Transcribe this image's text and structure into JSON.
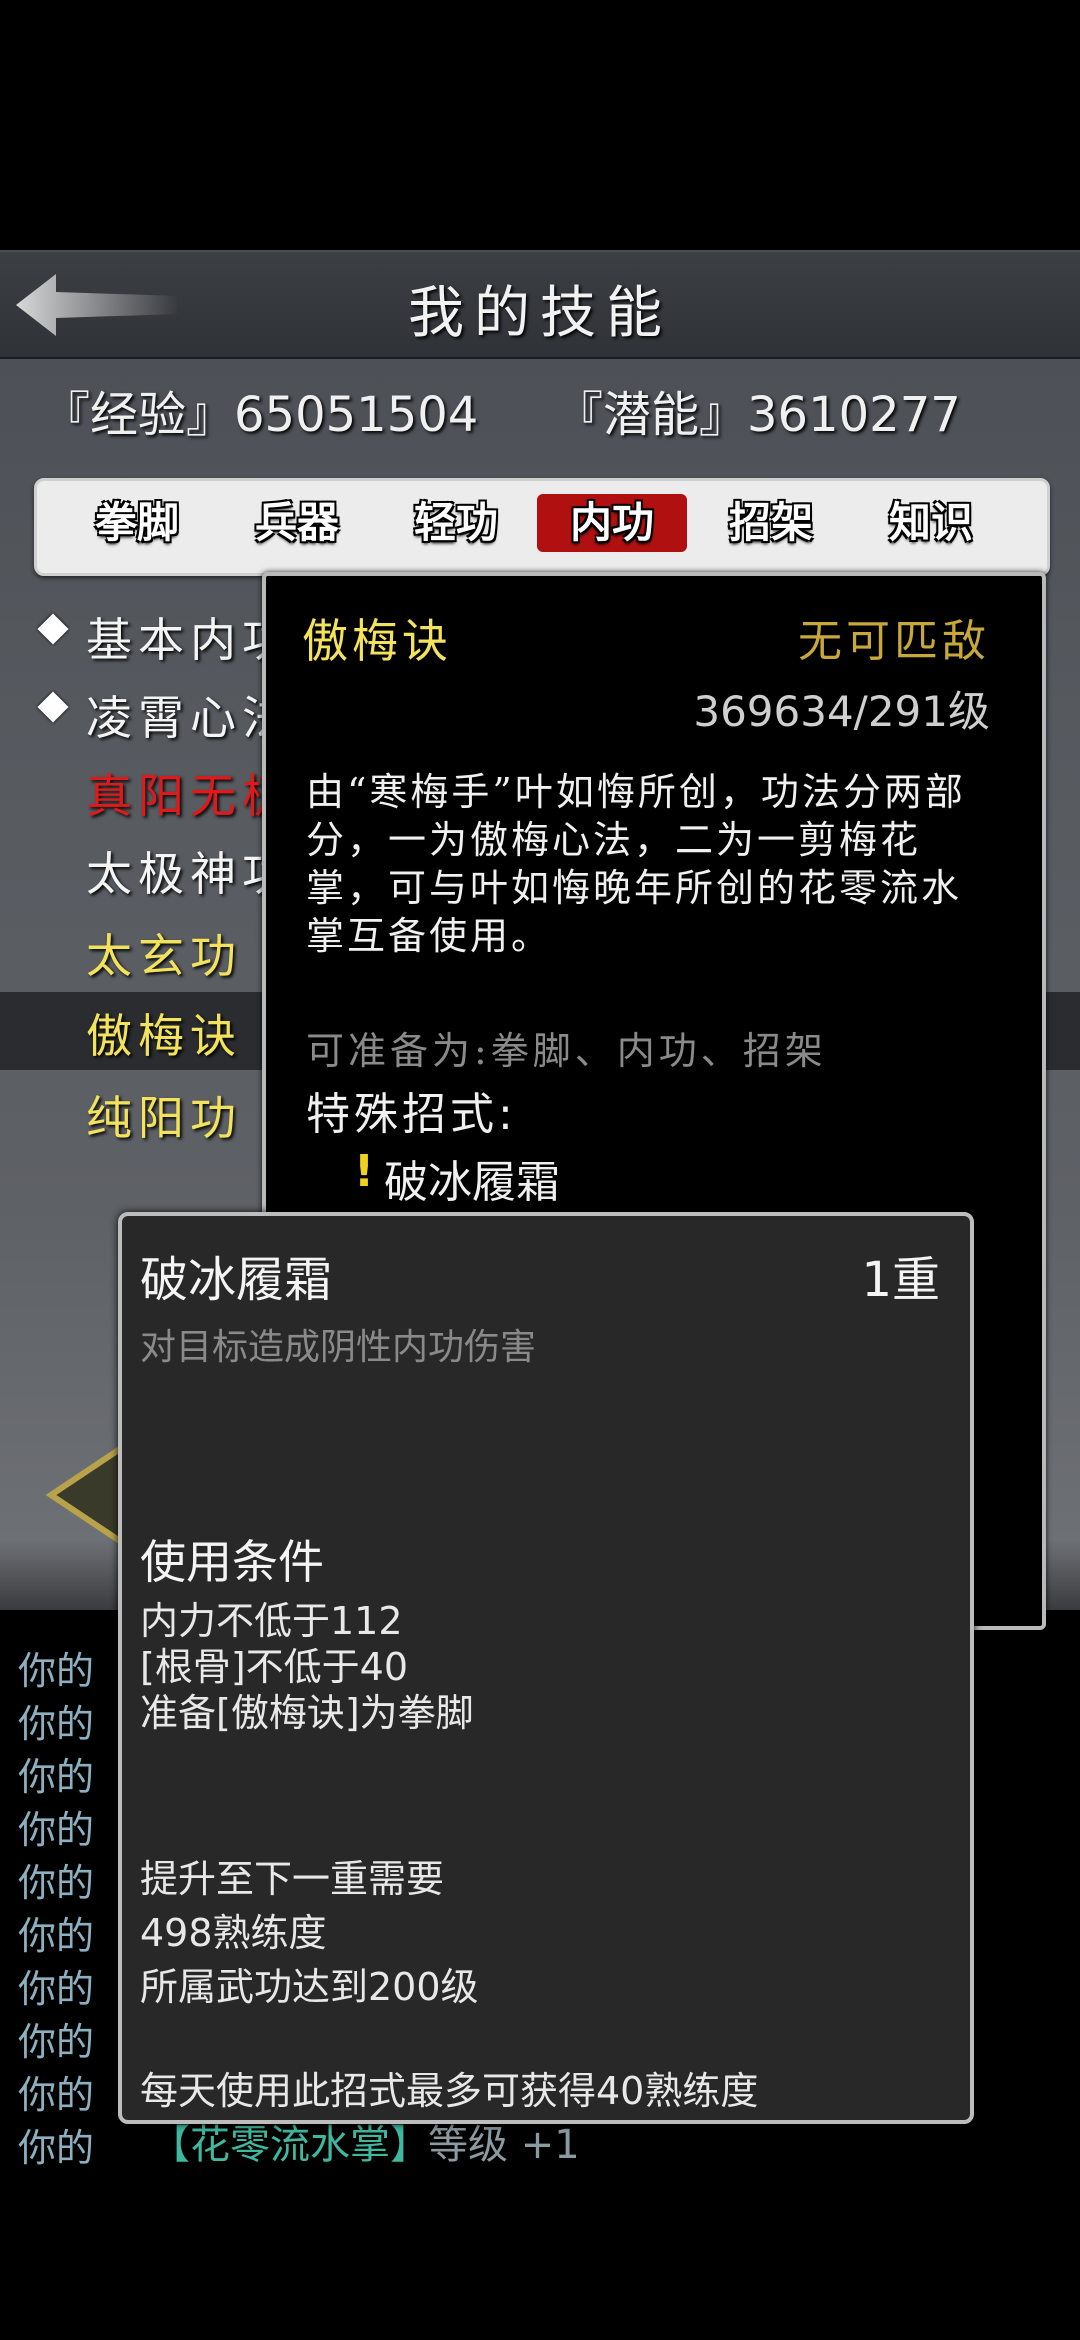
{
  "header": {
    "title": "我的技能"
  },
  "stats": {
    "experience": "『经验』65051504",
    "potential": "『潜能』3610277"
  },
  "tabs": [
    {
      "label": "拳脚"
    },
    {
      "label": "兵器"
    },
    {
      "label": "轻功"
    },
    {
      "label": "内功"
    },
    {
      "label": "招架"
    },
    {
      "label": "知识"
    }
  ],
  "active_tab": "内功",
  "skills": [
    {
      "name": "基本内功",
      "visible": "基本内功"
    },
    {
      "name": "凌霄心法",
      "visible": "凌霄心法"
    },
    {
      "name": "真阳无极",
      "visible": "真阳无极"
    },
    {
      "name": "太极神功",
      "visible": "太极神功"
    },
    {
      "name": "太玄功",
      "visible": "太玄功"
    },
    {
      "name": "傲梅诀",
      "visible": "傲梅诀"
    },
    {
      "name": "纯阳功",
      "visible": "纯阳功"
    }
  ],
  "detail": {
    "name": "傲梅诀",
    "rank": "无可匹敌",
    "level": "369634/291级",
    "description": "由“寒梅手”叶如悔所创，功法分两部分，一为傲梅心法，二为一剪梅花掌，可与叶如悔晚年所创的花零流水掌互备使用。",
    "prepare_as": "可准备为:拳脚、内功、招架",
    "special_title": "特殊招式:",
    "special_marker": "!",
    "special_move": "破冰履霜"
  },
  "move": {
    "name": "破冰履霜",
    "level": "1重",
    "effect": "对目标造成阴性内功伤害",
    "conditions_title": "使用条件",
    "conditions": [
      "内力不低于112",
      "[根骨]不低于40",
      "准备[傲梅诀]为拳脚"
    ],
    "upgrade_title": "提升至下一重需要",
    "upgrade": [
      "498熟练度",
      "所属武功达到200级"
    ],
    "daily": "每天使用此招式最多可获得40熟练度"
  },
  "log": {
    "prefix": "你的",
    "last_skill": "【花零流水掌】",
    "last_level": "等级 +1"
  },
  "colors": {
    "gold": "#f3e25c",
    "red_tab": "#b01010",
    "rank_gold": "#c9a83a",
    "log_teal": "#3fb8a0"
  }
}
